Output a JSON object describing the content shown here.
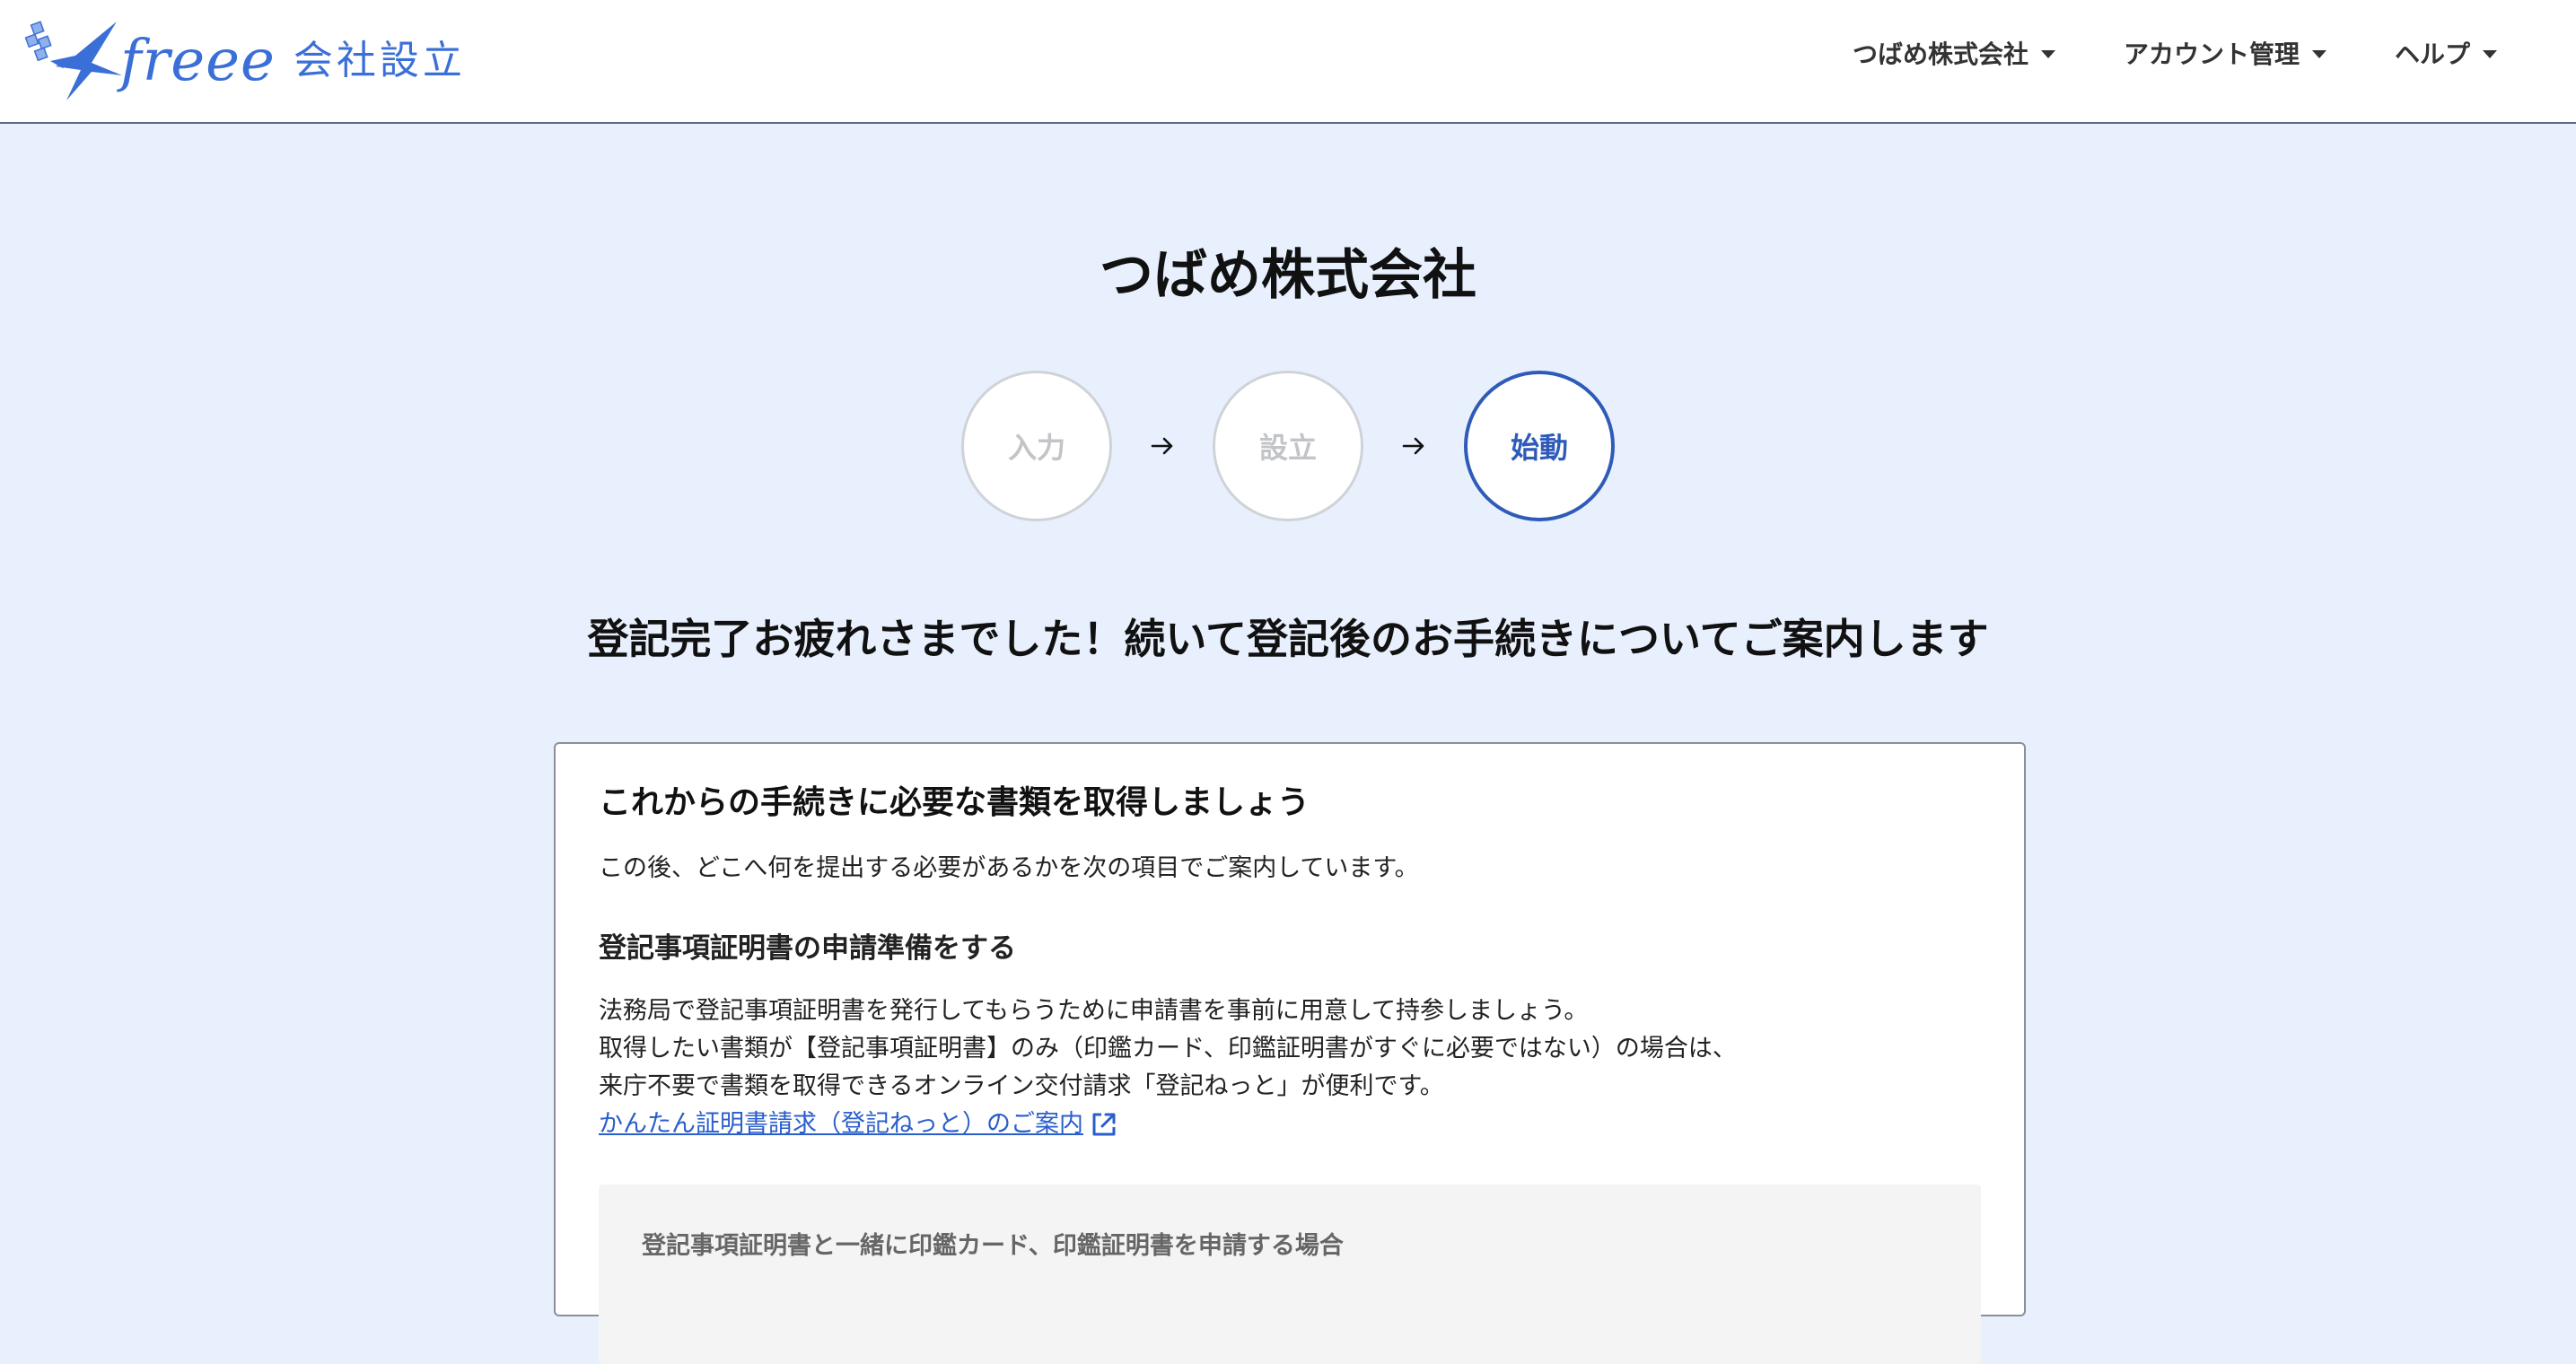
{
  "header": {
    "logo_word": "freee",
    "logo_product": "会社設立",
    "nav": [
      {
        "label": "つばめ株式会社"
      },
      {
        "label": "アカウント管理"
      },
      {
        "label": "ヘルプ"
      }
    ]
  },
  "page": {
    "company_name": "つばめ株式会社",
    "steps": [
      {
        "label": "入力",
        "state": "done"
      },
      {
        "label": "設立",
        "state": "done"
      },
      {
        "label": "始動",
        "state": "current"
      }
    ],
    "headline": "登記完了お疲れさまでした！続いて登記後のお手続きについてご案内します"
  },
  "card": {
    "title": "これからの手続きに必要な書類を取得しましょう",
    "description": "この後、どこへ何を提出する必要があるかを次の項目でご案内しています。",
    "section_title": "登記事項証明書の申請準備をする",
    "paragraph_lines": [
      "法務局で登記事項証明書を発行してもらうために申請書を事前に用意して持参しましょう。",
      "取得したい書類が【登記事項証明書】のみ（印鑑カード、印鑑証明書がすぐに必要ではない）の場合は、",
      "来庁不要で書類を取得できるオンライン交付請求「登記ねっと」が便利です。"
    ],
    "link_label": "かんたん証明書請求（登記ねっと）のご案内",
    "subbox_title": "登記事項証明書と一緒に印鑑カード、印鑑証明書を申請する場合"
  },
  "colors": {
    "brand": "#3b6fd8",
    "active_step": "#2f5bb8",
    "link": "#2a5ecb",
    "page_background": "#e9f0fd"
  },
  "icons": {
    "logo": "swallow-logo-icon",
    "dropdown": "caret-down-icon",
    "step_arrow": "arrow-right-icon",
    "external_link": "external-link-icon"
  }
}
